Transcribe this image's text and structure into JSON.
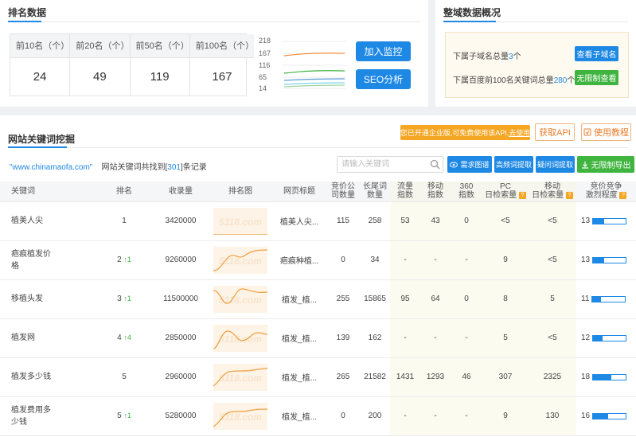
{
  "rank": {
    "title": "排名数据",
    "stats": [
      {
        "label": "前10名（个）",
        "value": "24"
      },
      {
        "label": "前20名（个）",
        "value": "49"
      },
      {
        "label": "前50名（个）",
        "value": "119"
      },
      {
        "label": "前100名（个）",
        "value": "167"
      }
    ],
    "chart_ticks": [
      "218",
      "167",
      "116",
      "65",
      "14"
    ],
    "monitor_btn": "加入监控",
    "seo_btn": "SEO分析"
  },
  "overview": {
    "title": "整域数据概况",
    "subdomain_prefix": "下属子域名总量",
    "subdomain_count": "3",
    "subdomain_suffix": "个",
    "subdomain_btn": "查看子域名",
    "baidu_prefix": "下属百度前100名关键词总量",
    "baidu_count": "280",
    "baidu_suffix": "个",
    "unlimited_btn": "无限制查看"
  },
  "keywords": {
    "title": "网站关键词挖掘",
    "promo_text": "您已开通企业版,可免费使用该API,",
    "promo_link": "去使用",
    "api_btn": "获取API",
    "tutorial_btn": "使用教程",
    "site": "\"www.chinamaofa.com\"",
    "found_prefix": "网站关键词共找到[",
    "found_count": "301",
    "found_suffix": "]条记录",
    "search_placeholder": "请输入关键词",
    "btn_demand": "需求图谱",
    "btn_freq": "高频词提取",
    "btn_question": "疑问词提取",
    "btn_export": "无限制导出",
    "headers": {
      "keyword": "关键词",
      "rank": "排名",
      "indexed": "收录量",
      "rank_chart": "排名图",
      "page_title": "网页标题",
      "bid_count_1": "竞价公",
      "bid_count_2": "司数量",
      "longtail_1": "长尾词",
      "longtail_2": "数量",
      "traffic_1": "流量",
      "traffic_2": "指数",
      "mobile_1": "移动",
      "mobile_2": "指数",
      "s360_1": "360",
      "s360_2": "指数",
      "pc_1": "PC",
      "pc_2": "日检索量",
      "mob_1": "移动",
      "mob_2": "日检索量",
      "comp_1": "竞价竞争",
      "comp_2": "激烈程度"
    },
    "rows": [
      {
        "kw1": "植美人尖",
        "kw2": "",
        "rank": "1",
        "up": "",
        "indexed": "3420000",
        "title": "植美人尖...",
        "bid": "115",
        "longtail": "258",
        "traffic": "53",
        "mobile": "43",
        "s360": "0",
        "pc": "<5",
        "mob": "<5",
        "comp": "13",
        "comp_pct": 0.33,
        "line": "M0,34 L68,34"
      },
      {
        "kw1": "疤痕植发价",
        "kw2": "格",
        "rank": "2",
        "up": "↑1",
        "indexed": "9260000",
        "title": "疤痕种植...",
        "bid": "0",
        "longtail": "34",
        "traffic": "-",
        "mobile": "-",
        "s360": "-",
        "pc": "9",
        "mob": "<5",
        "comp": "13",
        "comp_pct": 0.33,
        "line": "M0,30 C8,30 12,20 18,14 C26,6 30,16 38,12 C46,6 52,4 68,4"
      },
      {
        "kw1": "移植头发",
        "kw2": "",
        "rank": "3",
        "up": "↑1",
        "indexed": "11500000",
        "title": "植发_植...",
        "bid": "255",
        "longtail": "15865",
        "traffic": "95",
        "mobile": "64",
        "s360": "0",
        "pc": "8",
        "mob": "5",
        "comp": "11",
        "comp_pct": 0.25,
        "line": "M0,6 C8,6 10,20 16,22 C24,24 28,4 36,4 C44,4 50,10 68,8"
      },
      {
        "kw1": "植发网",
        "kw2": "",
        "rank": "4",
        "up": "↑4",
        "indexed": "2850000",
        "title": "植发_植...",
        "bid": "139",
        "longtail": "162",
        "traffic": "-",
        "mobile": "-",
        "s360": "-",
        "pc": "5",
        "mob": "<5",
        "comp": "12",
        "comp_pct": 0.28,
        "line": "M0,30 C6,30 10,8 18,8 C26,8 30,20 36,20 C44,20 48,10 56,10 C60,10 64,12 68,12"
      },
      {
        "kw1": "植发多少钱",
        "kw2": "",
        "rank": "5",
        "up": "",
        "indexed": "2960000",
        "title": "植发_植...",
        "bid": "265",
        "longtail": "21582",
        "traffic": "1431",
        "mobile": "1293",
        "s360": "46",
        "pc": "307",
        "mob": "2325",
        "comp": "18",
        "comp_pct": 0.55,
        "line": "M0,28 C8,22 12,12 20,10 C30,8 40,10 50,8 C56,7 62,6 68,6"
      },
      {
        "kw1": "植发费用多",
        "kw2": "少钱",
        "rank": "5",
        "up": "↑1",
        "indexed": "5280000",
        "title": "植发_植...",
        "bid": "0",
        "longtail": "200",
        "traffic": "-",
        "mobile": "-",
        "s360": "-",
        "pc": "9",
        "mob": "130",
        "comp": "16",
        "comp_pct": 0.45,
        "line": "M0,30 C8,26 12,14 20,12 C28,10 36,12 44,10 C54,8 60,8 68,8"
      }
    ]
  },
  "colors": {
    "accent": "#1e88e5",
    "green": "#3fb43f",
    "orange": "#f5a623"
  }
}
